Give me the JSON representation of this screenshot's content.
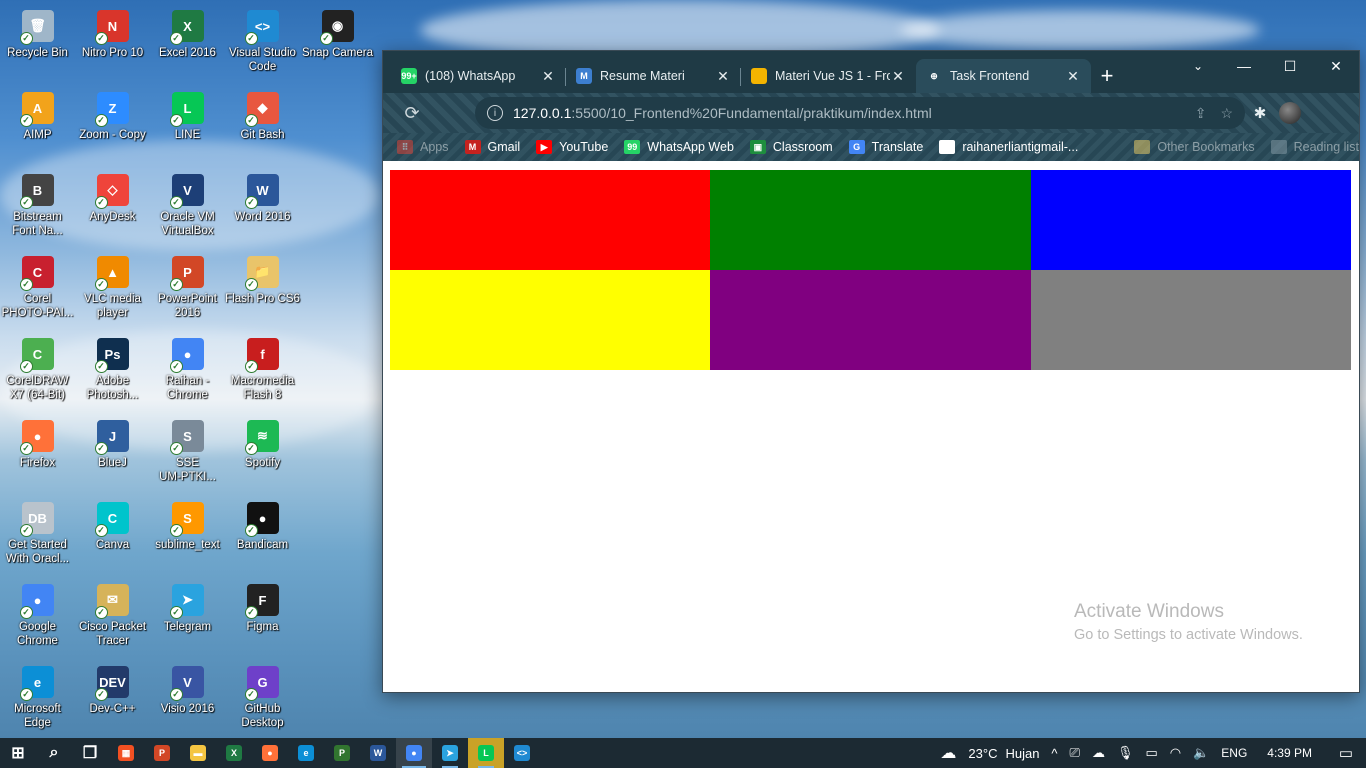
{
  "desktop": {
    "icons": [
      {
        "label": "Recycle Bin",
        "glyph": "🗑",
        "color": "#9fb6c9"
      },
      {
        "label": "Nitro Pro 10",
        "glyph": "N",
        "color": "#d9352b"
      },
      {
        "label": "Excel 2016",
        "glyph": "X",
        "color": "#1f7a43"
      },
      {
        "label": "Visual Studio\nCode",
        "glyph": "<>",
        "color": "#1f8ad2"
      },
      {
        "label": "Snap Camera",
        "glyph": "◉",
        "color": "#222"
      },
      {
        "label": "AIMP",
        "glyph": "A",
        "color": "#f2a31b"
      },
      {
        "label": "Zoom - Copy",
        "glyph": "Z",
        "color": "#2d8cff"
      },
      {
        "label": "LINE",
        "glyph": "L",
        "color": "#06c755"
      },
      {
        "label": "Git Bash",
        "glyph": "◆",
        "color": "#e8573f"
      },
      {
        "label": "Bitstream\nFont Na...",
        "glyph": "B",
        "color": "#444"
      },
      {
        "label": "AnyDesk",
        "glyph": "◇",
        "color": "#ef443b"
      },
      {
        "label": "Oracle VM\nVirtualBox",
        "glyph": "V",
        "color": "#1d3f77"
      },
      {
        "label": "Word 2016",
        "glyph": "W",
        "color": "#2b579a"
      },
      {
        "label": "Corel\nPHOTO-PAI...",
        "glyph": "C",
        "color": "#c8202f"
      },
      {
        "label": "VLC media\nplayer",
        "glyph": "▲",
        "color": "#f08a00"
      },
      {
        "label": "PowerPoint\n2016",
        "glyph": "P",
        "color": "#d24726"
      },
      {
        "label": "Flash Pro CS6",
        "glyph": "📁",
        "color": "#e9c46a"
      },
      {
        "label": "CorelDRAW\nX7 (64-Bit)",
        "glyph": "C",
        "color": "#4caf50"
      },
      {
        "label": "Adobe\nPhotosh...",
        "glyph": "Ps",
        "color": "#0f2f4f"
      },
      {
        "label": "Raihan -\nChrome",
        "glyph": "●",
        "color": "#4285f4"
      },
      {
        "label": "Macromedia\nFlash 8",
        "glyph": "f",
        "color": "#c81e1e"
      },
      {
        "label": "Firefox",
        "glyph": "●",
        "color": "#ff7139"
      },
      {
        "label": "BlueJ",
        "glyph": "J",
        "color": "#2f5f9e"
      },
      {
        "label": "SSE\nUM-PTKI...",
        "glyph": "S",
        "color": "#7a8a99"
      },
      {
        "label": "Spotify",
        "glyph": "≋",
        "color": "#1db954"
      },
      {
        "label": "Get Started\nWith Oracl...",
        "glyph": "DB",
        "color": "#b9c3cc"
      },
      {
        "label": "Canva",
        "glyph": "C",
        "color": "#00c4cc"
      },
      {
        "label": "sublime_text",
        "glyph": "S",
        "color": "#ff9800"
      },
      {
        "label": "Bandicam",
        "glyph": "●",
        "color": "#111"
      },
      {
        "label": "Google\nChrome",
        "glyph": "●",
        "color": "#4285f4"
      },
      {
        "label": "Cisco Packet\nTracer",
        "glyph": "✉",
        "color": "#d6b35a"
      },
      {
        "label": "Telegram",
        "glyph": "➤",
        "color": "#2aa3df"
      },
      {
        "label": "Figma",
        "glyph": "F",
        "color": "#222"
      },
      {
        "label": "Microsoft\nEdge",
        "glyph": "e",
        "color": "#0c8fd6"
      },
      {
        "label": "Dev-C++",
        "glyph": "DEV",
        "color": "#223a6a"
      },
      {
        "label": "Visio 2016",
        "glyph": "V",
        "color": "#3955a3"
      },
      {
        "label": "GitHub\nDesktop",
        "glyph": "G",
        "color": "#6e40c9"
      }
    ]
  },
  "browser": {
    "tabs": [
      {
        "title": "(108) WhatsApp",
        "favicon": "whatsapp-icon",
        "color": "#25d366",
        "glyph": "99+"
      },
      {
        "title": "Resume Materi",
        "favicon": "m-icon",
        "color": "#3d7fd0",
        "glyph": "M"
      },
      {
        "title": "Materi Vue JS 1 - Fro",
        "favicon": "slides-icon",
        "color": "#f4b400",
        "glyph": ""
      },
      {
        "title": "Task Frontend",
        "favicon": "globe-icon",
        "color": "#2a4c5b",
        "glyph": "⊕"
      }
    ],
    "new_tab": "+",
    "window_controls": {
      "dropdown": "⌄",
      "minimize": "—",
      "maximize": "☐",
      "close": "✕"
    },
    "url_host": "127.0.0.1",
    "url_path": ":5500/10_Frontend%20Fundamental/praktikum/index.html",
    "bookmarks": [
      {
        "label": "Apps",
        "icon": "apps-icon",
        "color": "#ea4335",
        "glyph": "⠿",
        "faded": true
      },
      {
        "label": "Gmail",
        "icon": "gmail-icon",
        "color": "#c5221f",
        "glyph": "M",
        "faded": false
      },
      {
        "label": "YouTube",
        "icon": "youtube-icon",
        "color": "#ff0000",
        "glyph": "▶",
        "faded": false
      },
      {
        "label": "WhatsApp Web",
        "icon": "whatsapp-icon",
        "color": "#25d366",
        "glyph": "99",
        "faded": false
      },
      {
        "label": "Classroom",
        "icon": "classroom-icon",
        "color": "#1e8e3e",
        "glyph": "▣",
        "faded": false
      },
      {
        "label": "Translate",
        "icon": "translate-icon",
        "color": "#4285f4",
        "glyph": "G",
        "faded": false
      },
      {
        "label": "raihanerliantigmail-...",
        "icon": "mail-icon",
        "color": "#ffffff",
        "glyph": "",
        "faded": false
      },
      {
        "label": "Other Bookmarks",
        "icon": "folder-icon",
        "color": "#f6d365",
        "glyph": "",
        "faded": true
      },
      {
        "label": "Reading list",
        "icon": "reading-list-icon",
        "color": "#8aa0aa",
        "glyph": "",
        "faded": true
      }
    ]
  },
  "page": {
    "blocks": [
      {
        "color": "#ff0000"
      },
      {
        "color": "#008000"
      },
      {
        "color": "#0000ff"
      },
      {
        "color": "#ffff00"
      },
      {
        "color": "#800080"
      },
      {
        "color": "#808080"
      }
    ],
    "watermark_title": "Activate Windows",
    "watermark_sub": "Go to Settings to activate Windows."
  },
  "taskbar": {
    "apps": [
      {
        "name": "start-button",
        "glyph": "⊞",
        "color": "transparent"
      },
      {
        "name": "search-icon",
        "glyph": "⌕",
        "color": "transparent"
      },
      {
        "name": "task-view-icon",
        "glyph": "❐",
        "color": "transparent"
      },
      {
        "name": "store-icon",
        "glyph": "▦",
        "color": "#f25022"
      },
      {
        "name": "powerpoint-icon",
        "glyph": "P",
        "color": "#d24726"
      },
      {
        "name": "file-explorer-icon",
        "glyph": "▬",
        "color": "#f4c542"
      },
      {
        "name": "excel-icon",
        "glyph": "X",
        "color": "#1f7a43"
      },
      {
        "name": "firefox-icon",
        "glyph": "●",
        "color": "#ff7139"
      },
      {
        "name": "edge-icon",
        "glyph": "e",
        "color": "#0c8fd6"
      },
      {
        "name": "project-icon",
        "glyph": "P",
        "color": "#31752f"
      },
      {
        "name": "word-icon",
        "glyph": "W",
        "color": "#2b579a"
      },
      {
        "name": "chrome-icon",
        "glyph": "●",
        "color": "#4285f4"
      },
      {
        "name": "telegram-icon",
        "glyph": "➤",
        "color": "#2aa3df"
      },
      {
        "name": "line-icon",
        "glyph": "L",
        "color": "#06c755"
      },
      {
        "name": "vscode-icon",
        "glyph": "<>",
        "color": "#1f8ad2"
      }
    ],
    "weather_temp": "23°C",
    "weather_text": "Hujan",
    "language": "ENG",
    "time": "4:39 PM"
  }
}
